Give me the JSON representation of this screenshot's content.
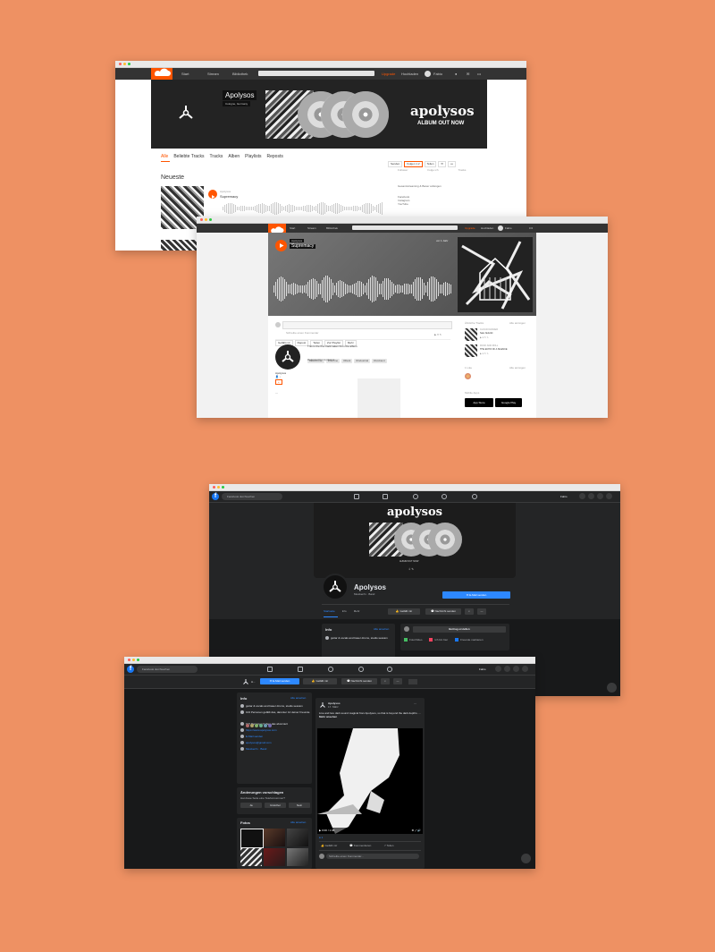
{
  "soundcloud_profile": {
    "nav": {
      "home": "Start",
      "stream": "Stream",
      "library": "Bibliothek",
      "search_placeholder": "Suchen",
      "upgrade": "Upgrade",
      "upload": "Hochladen",
      "user": "Fabio"
    },
    "artist_name": "Apolysos",
    "location": "Cologne, Germany",
    "banner_logo": "apolysos",
    "banner_tagline": "ALBUM OUT NOW",
    "tabs": [
      "Alle",
      "Beliebte Tracks",
      "Tracks",
      "Alben",
      "Playlists",
      "Reposts"
    ],
    "actions": {
      "station": "Senden",
      "follow": "Folgen 1.2",
      "share": "Teilen"
    },
    "stats": [
      "Follower",
      "Folge ich",
      "Tracks"
    ],
    "section_title": "Neueste",
    "track_artist": "Apolysos",
    "track_title": "Supremacy",
    "side_text": "Gesamtstreaming & Baner anfangen",
    "side_links": [
      "Facebook",
      "Instagram",
      "YouTube"
    ]
  },
  "soundcloud_track": {
    "nav": {
      "home": "Start",
      "stream": "Stream",
      "library": "Bibliothek",
      "search_placeholder": "Suchen",
      "upgrade": "Upgrade",
      "upload": "Hochladen",
      "user": "Fabio"
    },
    "track_artist": "Apolysos",
    "track_title": "Supremacy",
    "date": "vor 1 Jahr",
    "comment_placeholder": "Schreibe einen Kommentar",
    "buttons": [
      "Gefällt mir",
      "Repost",
      "Teilen",
      "Zur Playlist",
      "Mehr"
    ],
    "artist": "Apolysos",
    "description": "This is the first track taken from the album",
    "tags": [
      "#Electronic",
      "#Techno",
      "#Dark",
      "#Industrial",
      "#Ambient"
    ],
    "released": "Released by: Apolysos",
    "related_title": "Ähnliche Tracks",
    "view_all": "Alle anzeigen",
    "related": [
      {
        "artist": "CLOUD DANCER",
        "title": "Sale Nefertiti"
      },
      {
        "artist": "ROCK AND ROLL",
        "title": "THE ECHO OF A SILENCE"
      }
    ],
    "likes_title": "1 Like",
    "app_title": "Mobile Apps",
    "app_store": "App Store",
    "google_play": "Google Play"
  },
  "facebook_cover": {
    "search_placeholder": "Facebook durchsuchen",
    "page_name": "Apolysos",
    "category": "Musiker/in · Band",
    "cover_logo": "apolysos",
    "cover_tagline": "ALBUM OUT NOW",
    "cta": "E-Mail senden",
    "tabs": [
      "Startseite",
      "Info",
      "Mehr"
    ],
    "like": "Gefällt mir",
    "message": "Nachricht senden",
    "info_title": "Info",
    "see_all": "Alle ansehen",
    "about": "guitar & vocals and baser drums, studio session",
    "create_post": "Beitrag erstellen",
    "post_actions": [
      "Foto/Video",
      "Ich bin hier",
      "Freunde markieren"
    ],
    "profile_name": "Fabio"
  },
  "facebook_feed": {
    "search_placeholder": "Facebook durchsuchen",
    "cta": "E-Mail senden",
    "like": "Gefällt mir",
    "message": "Nachricht senden",
    "info_title": "Info",
    "see_all": "Alle ansehen",
    "info_items": [
      "guitar & vocals and baser drums, studio session",
      "104 Personen gefällt das, darunter 12 deiner Freunde",
      "107 Personen haben das abonniert",
      "https://www.apolysos.com",
      "E-Mail senden",
      "apolysos@gmail.com",
      "Musiker/in · Band"
    ],
    "suggest_title": "Änderungen vorschlagen",
    "suggest_q": "Hat diese Seite eine Telefonnummer?",
    "suggest_buttons": [
      "Ja",
      "Unsicher",
      "Nein"
    ],
    "photos_title": "Fotos",
    "post_author": "Apolysos",
    "post_time": "17. März",
    "post_text": "Live and lore dark sound magical from Apolysos, so that is beyond the dark depths. ...",
    "post_more": "Mehr ansehen",
    "video_time": "0:00 / 1:38",
    "post_actions": [
      "Gefällt mir",
      "Kommentieren",
      "Teilen"
    ],
    "comment_placeholder": "Schreibe einen Kommentar...",
    "profile_name": "Fabio"
  }
}
